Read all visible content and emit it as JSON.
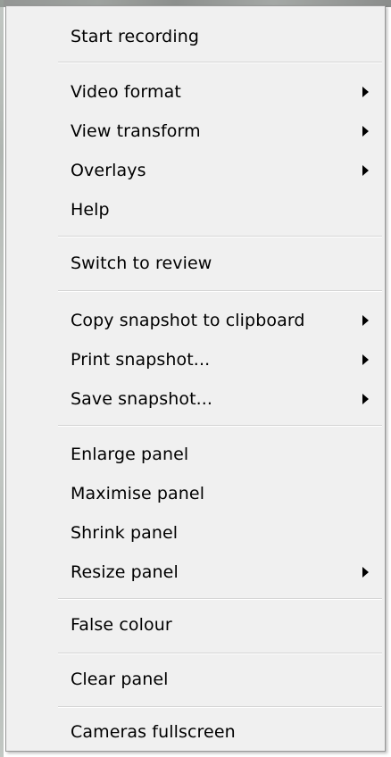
{
  "menu": {
    "items": [
      {
        "label": "Start recording"
      },
      {
        "label": "Video format",
        "has_submenu": true
      },
      {
        "label": "View transform",
        "has_submenu": true
      },
      {
        "label": "Overlays",
        "has_submenu": true
      },
      {
        "label": "Help"
      },
      {
        "label": "Switch to review"
      },
      {
        "label": "Copy snapshot to clipboard",
        "has_submenu": true
      },
      {
        "label": "Print snapshot...",
        "has_submenu": true
      },
      {
        "label": "Save snapshot...",
        "has_submenu": true
      },
      {
        "label": "Enlarge panel"
      },
      {
        "label": "Maximise panel"
      },
      {
        "label": "Shrink panel"
      },
      {
        "label": "Resize panel",
        "has_submenu": true
      },
      {
        "label": "False colour"
      },
      {
        "label": "Clear panel"
      },
      {
        "label": "Cameras fullscreen"
      }
    ]
  },
  "colors": {
    "menu_background": "#f0f0f0",
    "menu_border": "#979797",
    "separator": "#d5d5d5",
    "text": "#000000"
  },
  "icons": {
    "submenu_arrow": "chevron-right-icon"
  }
}
